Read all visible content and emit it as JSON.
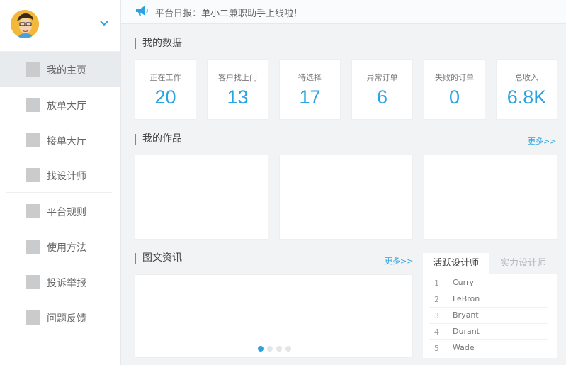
{
  "notice": {
    "icon": "megaphone-icon",
    "text": "平台日报：单小二兼职助手上线啦！"
  },
  "sidebar": {
    "items": [
      {
        "label": "我的主页",
        "active": true
      },
      {
        "label": "放单大厅"
      },
      {
        "label": "接单大厅"
      },
      {
        "label": "找设计师"
      },
      {
        "label": "平台规则"
      },
      {
        "label": "使用方法"
      },
      {
        "label": "投诉举报"
      },
      {
        "label": "问题反馈"
      }
    ]
  },
  "my_data": {
    "title": "我的数据",
    "stats": [
      {
        "label": "正在工作",
        "value": "20"
      },
      {
        "label": "客户找上门",
        "value": "13"
      },
      {
        "label": "待选择",
        "value": "17"
      },
      {
        "label": "异常订单",
        "value": "6"
      },
      {
        "label": "失败的订单",
        "value": "0"
      },
      {
        "label": "总收入",
        "value": "6.8K"
      }
    ]
  },
  "works": {
    "title": "我的作品",
    "more": "更多>>"
  },
  "news": {
    "title": "图文资讯",
    "more": "更多>>",
    "slide_count": 4,
    "active_slide": 1
  },
  "designers": {
    "tabs": [
      "活跃设计师",
      "实力设计师"
    ],
    "active_tab": 0,
    "list": [
      {
        "rank": "1",
        "name": "Curry"
      },
      {
        "rank": "2",
        "name": "LeBron"
      },
      {
        "rank": "3",
        "name": "Bryant"
      },
      {
        "rank": "4",
        "name": "Durant"
      },
      {
        "rank": "5",
        "name": "Wade"
      }
    ]
  },
  "colors": {
    "accent": "#2aa3e3",
    "avatar_bg": "#f3b73a"
  }
}
